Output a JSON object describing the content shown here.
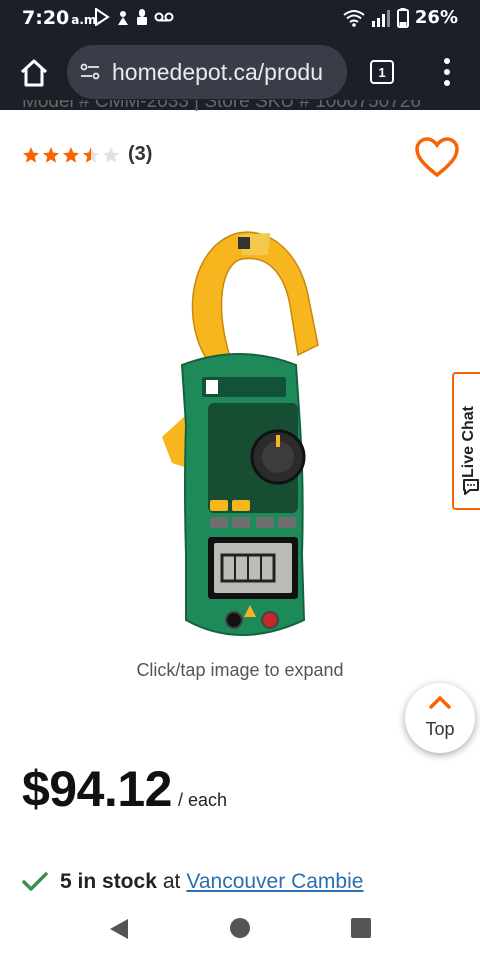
{
  "status_bar": {
    "time": "7:20",
    "ampm": "a.m.",
    "battery": "26%",
    "network": "LTE"
  },
  "browser": {
    "url": "homedepot.ca/produ",
    "tab_count": "1"
  },
  "product": {
    "model_line": "Model # CMM-2033  |  Store SKU # 1000750726",
    "rating_value": 3.5,
    "rating_max": 5,
    "rating_count": "(3)",
    "image_caption": "Click/tap image to expand",
    "price": "$94.12",
    "price_unit": "/ each"
  },
  "stock": {
    "quantity": "5 in stock",
    "at": "at",
    "store": "Vancouver Cambie"
  },
  "widgets": {
    "live_chat": "Live Chat",
    "top": "Top"
  },
  "colors": {
    "brand_orange": "#f96302",
    "star": "#f96302",
    "stock_check": "#3f8f4c",
    "store_link": "#2a6fb0"
  }
}
